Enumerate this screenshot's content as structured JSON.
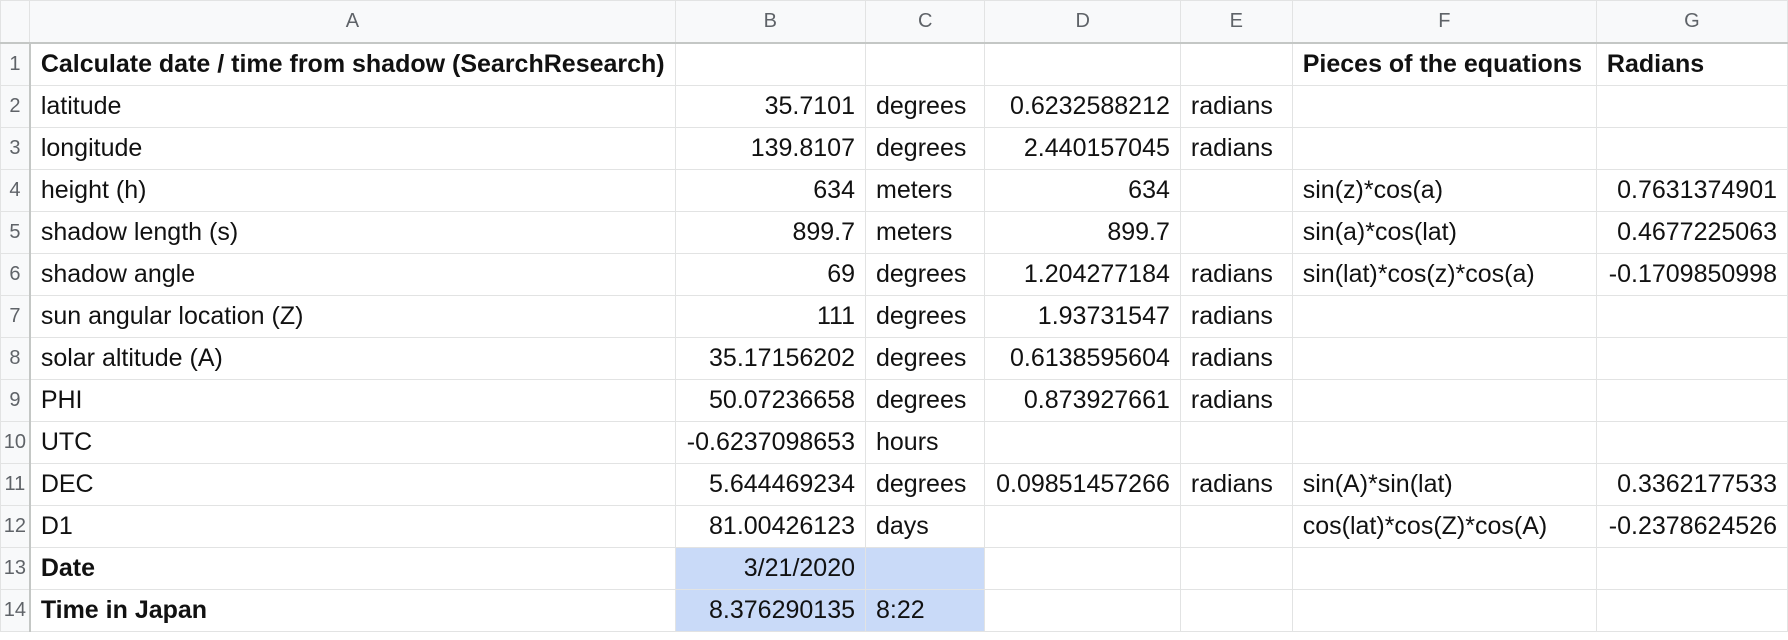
{
  "columns": [
    "A",
    "B",
    "C",
    "D",
    "E",
    "F",
    "G"
  ],
  "rows": [
    {
      "num": "1",
      "A": "Calculate date / time from shadow (SearchResearch)",
      "B": "",
      "C": "",
      "D": "",
      "E": "",
      "F": "Pieces of the equations",
      "G": "Radians"
    },
    {
      "num": "2",
      "A": "latitude",
      "B": "35.7101",
      "C": "degrees",
      "D": "0.6232588212",
      "E": "radians",
      "F": "",
      "G": ""
    },
    {
      "num": "3",
      "A": "longitude",
      "B": "139.8107",
      "C": "degrees",
      "D": "2.440157045",
      "E": "radians",
      "F": "",
      "G": ""
    },
    {
      "num": "4",
      "A": "height (h)",
      "B": "634",
      "C": "meters",
      "D": "634",
      "E": "",
      "F": "sin(z)*cos(a)",
      "G": "0.7631374901"
    },
    {
      "num": "5",
      "A": "shadow length (s)",
      "B": "899.7",
      "C": "meters",
      "D": "899.7",
      "E": "",
      "F": "sin(a)*cos(lat)",
      "G": "0.4677225063"
    },
    {
      "num": "6",
      "A": "shadow angle",
      "B": "69",
      "C": "degrees",
      "D": "1.204277184",
      "E": "radians",
      "F": "sin(lat)*cos(z)*cos(a)",
      "G": "-0.1709850998"
    },
    {
      "num": "7",
      "A": "sun angular location (Z)",
      "B": "111",
      "C": "degrees",
      "D": "1.93731547",
      "E": "radians",
      "F": "",
      "G": ""
    },
    {
      "num": "8",
      "A": "solar altitude (A)",
      "B": "35.17156202",
      "C": "degrees",
      "D": "0.6138595604",
      "E": "radians",
      "F": "",
      "G": ""
    },
    {
      "num": "9",
      "A": "PHI",
      "B": "50.07236658",
      "C": "degrees",
      "D": "0.873927661",
      "E": "radians",
      "F": "",
      "G": ""
    },
    {
      "num": "10",
      "A": "UTC",
      "B": "-0.6237098653",
      "C": "hours",
      "D": "",
      "E": "",
      "F": "",
      "G": ""
    },
    {
      "num": "11",
      "A": "DEC",
      "B": "5.644469234",
      "C": "degrees",
      "D": "0.09851457266",
      "E": "radians",
      "F": "sin(A)*sin(lat)",
      "G": "0.3362177533"
    },
    {
      "num": "12",
      "A": "D1",
      "B": "81.00426123",
      "C": "days",
      "D": "",
      "E": "",
      "F": "cos(lat)*cos(Z)*cos(A)",
      "G": "-0.2378624526"
    },
    {
      "num": "13",
      "A": "Date",
      "B": "3/21/2020",
      "C": "",
      "D": "",
      "E": "",
      "F": "",
      "G": ""
    },
    {
      "num": "14",
      "A": "Time in Japan",
      "B": "8.376290135",
      "C": "8:22",
      "D": "",
      "E": "",
      "F": "",
      "G": ""
    }
  ],
  "colors": {
    "selection": "#c9daf8",
    "header_bg": "#f8f9fa",
    "grid": "#e2e3e3"
  }
}
